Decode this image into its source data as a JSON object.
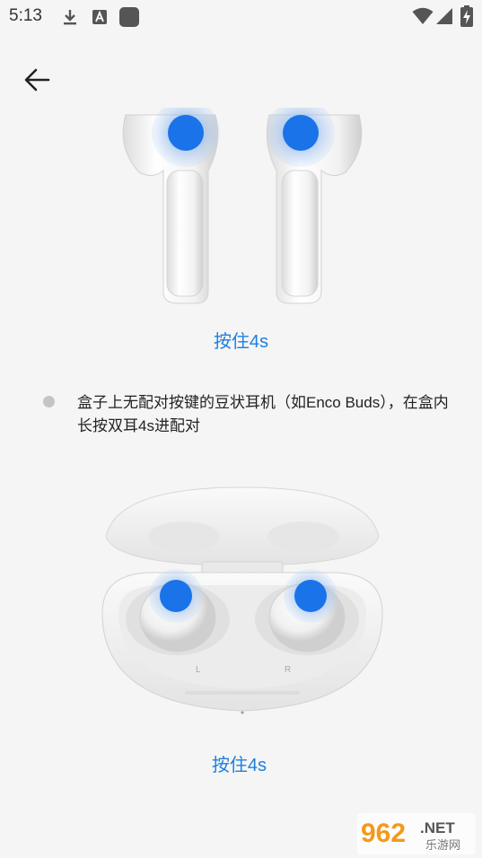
{
  "status_bar": {
    "time": "5:13",
    "left_icons": [
      "download-icon",
      "text-a-icon",
      "app-square-icon"
    ],
    "right_icons": [
      "wifi-icon",
      "cellular-signal-icon",
      "battery-charging-icon"
    ]
  },
  "nav": {
    "back_icon": "back-arrow-icon"
  },
  "section1": {
    "caption": "按住4s"
  },
  "bullet": {
    "text": "盒子上无配对按键的豆状耳机（如Enco Buds），在盒内长按双耳4s进配对"
  },
  "section2": {
    "case_left_mark": "L",
    "case_right_mark": "R",
    "caption": "按住4s"
  },
  "watermark": {
    "number": "962",
    "suffix": ".NET",
    "site": "乐游网"
  },
  "colors": {
    "accent": "#1d7fe0",
    "press_dot": "#1a73e8",
    "background": "#f5f5f5"
  }
}
